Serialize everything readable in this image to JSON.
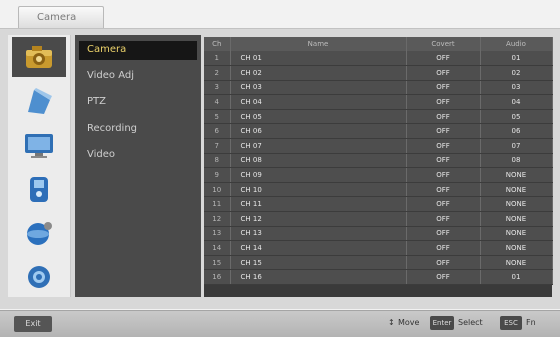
{
  "tab": {
    "label": "Camera"
  },
  "sidebar_icons": [
    {
      "name": "camera-icon"
    },
    {
      "name": "display-icon"
    },
    {
      "name": "monitor-icon"
    },
    {
      "name": "record-icon"
    },
    {
      "name": "network-icon"
    },
    {
      "name": "settings-icon"
    }
  ],
  "menu": {
    "items": [
      {
        "label": "Camera",
        "active": true
      },
      {
        "label": "Video Adj",
        "active": false
      },
      {
        "label": "PTZ",
        "active": false
      },
      {
        "label": "Recording",
        "active": false
      },
      {
        "label": "Video",
        "active": false
      }
    ]
  },
  "grid": {
    "headers": [
      "Ch",
      "Name",
      "Covert",
      "Audio"
    ],
    "rows": [
      [
        "1",
        "CH 01",
        "OFF",
        "01"
      ],
      [
        "2",
        "CH 02",
        "OFF",
        "02"
      ],
      [
        "3",
        "CH 03",
        "OFF",
        "03"
      ],
      [
        "4",
        "CH 04",
        "OFF",
        "04"
      ],
      [
        "5",
        "CH 05",
        "OFF",
        "05"
      ],
      [
        "6",
        "CH 06",
        "OFF",
        "06"
      ],
      [
        "7",
        "CH 07",
        "OFF",
        "07"
      ],
      [
        "8",
        "CH 08",
        "OFF",
        "08"
      ],
      [
        "9",
        "CH 09",
        "OFF",
        "NONE"
      ],
      [
        "10",
        "CH 10",
        "OFF",
        "NONE"
      ],
      [
        "11",
        "CH 11",
        "OFF",
        "NONE"
      ],
      [
        "12",
        "CH 12",
        "OFF",
        "NONE"
      ],
      [
        "13",
        "CH 13",
        "OFF",
        "NONE"
      ],
      [
        "14",
        "CH 14",
        "OFF",
        "NONE"
      ],
      [
        "15",
        "CH 15",
        "OFF",
        "NONE"
      ],
      [
        "16",
        "CH 16",
        "OFF",
        "01"
      ]
    ]
  },
  "statusbar": {
    "exit_label": "Exit",
    "move_label": "Move",
    "select_key": "Enter",
    "select_label": "Select",
    "fn_key": "ESC",
    "fn_label": "Fn"
  }
}
